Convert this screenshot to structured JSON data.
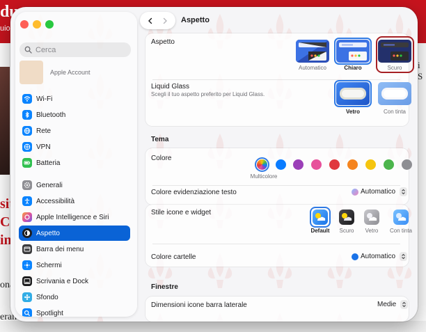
{
  "background_page": {
    "logo_fragment": "du",
    "subtitle_fragment": "uio",
    "headline_lines": [
      "sit",
      "Ca",
      "in"
    ],
    "body_fragments": [
      "ona",
      "eran"
    ],
    "right_fragment": "i S"
  },
  "window": {
    "title": "Aspetto"
  },
  "sidebar": {
    "search_placeholder": "Cerca",
    "account_label": "Apple Account",
    "items": [
      {
        "label": "Wi-Fi",
        "icon": "wifi-icon",
        "color": "#0a84ff"
      },
      {
        "label": "Bluetooth",
        "icon": "bluetooth-icon",
        "color": "#0a84ff"
      },
      {
        "label": "Rete",
        "icon": "globe-icon",
        "color": "#0a84ff"
      },
      {
        "label": "VPN",
        "icon": "vpn-icon",
        "color": "#0a84ff"
      },
      {
        "label": "Batteria",
        "icon": "battery-icon",
        "color": "#30c04f"
      },
      {
        "label": "Generali",
        "icon": "gear-icon",
        "color": "#8e8e93"
      },
      {
        "label": "Accessibilità",
        "icon": "accessibility-icon",
        "color": "#0a84ff"
      },
      {
        "label": "Apple Intelligence e Siri",
        "icon": "siri-icon",
        "color": "#e0529c"
      },
      {
        "label": "Aspetto",
        "icon": "appearance-icon",
        "color": "#1d1d1f"
      },
      {
        "label": "Barra dei menu",
        "icon": "menubar-icon",
        "color": "#3a3a3c"
      },
      {
        "label": "Schermi",
        "icon": "display-icon",
        "color": "#0a84ff"
      },
      {
        "label": "Scrivania e Dock",
        "icon": "dock-icon",
        "color": "#1d1d1f"
      },
      {
        "label": "Sfondo",
        "icon": "wallpaper-icon",
        "color": "#32ade6"
      },
      {
        "label": "Spotlight",
        "icon": "spotlight-icon",
        "color": "#0a84ff"
      }
    ],
    "active_item": "Aspetto"
  },
  "main": {
    "appearance": {
      "label": "Aspetto",
      "options": [
        "Automatico",
        "Chiaro",
        "Scuro"
      ],
      "selected": "Chiaro"
    },
    "liquid_glass": {
      "label": "Liquid Glass",
      "description": "Scegli il tuo aspetto preferito per Liquid Glass.",
      "options": [
        "Vetro",
        "Con tinta"
      ],
      "selected": "Vetro"
    },
    "theme": {
      "section_title": "Tema",
      "color_label": "Colore",
      "selected_caption": "Multicolore",
      "swatches": [
        "#0a7cff",
        "#9b3fb8",
        "#e7519b",
        "#e0383e",
        "#f5841f",
        "#f5c50f",
        "#4cb54c",
        "#8e8e93"
      ],
      "highlight_label": "Colore evidenziazione testo",
      "highlight_value": "Automatico",
      "icon_style_label": "Stile icone e widget",
      "icon_styles": [
        "Default",
        "Scuro",
        "Vetro",
        "Con tinta"
      ],
      "icon_style_selected": "Default",
      "folder_color_label": "Colore cartelle",
      "folder_color_value": "Automatico"
    },
    "windows": {
      "section_title": "Finestre",
      "sidebar_icon_size_label": "Dimensioni icone barra laterale",
      "sidebar_icon_size_value": "Medie"
    }
  },
  "colors": {
    "accent": "#0a63d6",
    "selection_ring": "#2f7ae5",
    "annotation_ring": "#a62024",
    "site_red": "#c8141e"
  }
}
